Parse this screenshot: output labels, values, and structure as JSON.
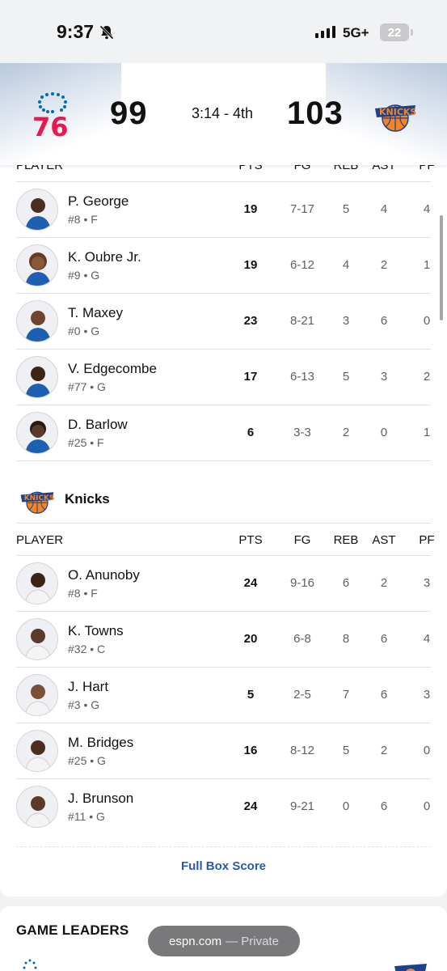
{
  "status_bar": {
    "time": "9:37",
    "network": "5G+",
    "battery": "22"
  },
  "scoreboard": {
    "home_score": "99",
    "clock": "3:14 - 4th",
    "away_score": "103"
  },
  "columns": {
    "player": "PLAYER",
    "pts": "PTS",
    "fg": "FG",
    "reb": "REB",
    "ast": "AST",
    "pf": "PF"
  },
  "sixers_players": [
    {
      "name": "P. George",
      "info": "#8 • F",
      "pts": "19",
      "fg": "7-17",
      "reb": "5",
      "ast": "4",
      "pf": "4"
    },
    {
      "name": "K. Oubre Jr.",
      "info": "#9 • G",
      "pts": "19",
      "fg": "6-12",
      "reb": "4",
      "ast": "2",
      "pf": "1"
    },
    {
      "name": "T. Maxey",
      "info": "#0 • G",
      "pts": "23",
      "fg": "8-21",
      "reb": "3",
      "ast": "6",
      "pf": "0"
    },
    {
      "name": "V. Edgecombe",
      "info": "#77 • G",
      "pts": "17",
      "fg": "6-13",
      "reb": "5",
      "ast": "3",
      "pf": "2"
    },
    {
      "name": "D. Barlow",
      "info": "#25 • F",
      "pts": "6",
      "fg": "3-3",
      "reb": "2",
      "ast": "0",
      "pf": "1"
    }
  ],
  "knicks": {
    "team_name": "Knicks"
  },
  "knicks_players": [
    {
      "name": "O. Anunoby",
      "info": "#8 • F",
      "pts": "24",
      "fg": "9-16",
      "reb": "6",
      "ast": "2",
      "pf": "3"
    },
    {
      "name": "K. Towns",
      "info": "#32 • C",
      "pts": "20",
      "fg": "6-8",
      "reb": "8",
      "ast": "6",
      "pf": "4"
    },
    {
      "name": "J. Hart",
      "info": "#3 • G",
      "pts": "5",
      "fg": "2-5",
      "reb": "7",
      "ast": "6",
      "pf": "3"
    },
    {
      "name": "M. Bridges",
      "info": "#25 • G",
      "pts": "16",
      "fg": "8-12",
      "reb": "5",
      "ast": "2",
      "pf": "0"
    },
    {
      "name": "J. Brunson",
      "info": "#11 • G",
      "pts": "24",
      "fg": "9-21",
      "reb": "0",
      "ast": "6",
      "pf": "0"
    }
  ],
  "links": {
    "full_box_score": "Full Box Score"
  },
  "game_leaders": {
    "title": "GAME LEADERS"
  },
  "browser": {
    "domain": "espn.com",
    "mode": "— Private"
  },
  "colors": {
    "sixers_red": "#ed174c",
    "sixers_blue": "#006bb6",
    "knicks_orange": "#f58426",
    "knicks_blue": "#006bb6",
    "link_blue": "#2b5ba8"
  },
  "icons": [
    "bell-slash-icon",
    "signal-icon",
    "battery-icon",
    "sixers-logo",
    "knicks-logo"
  ]
}
